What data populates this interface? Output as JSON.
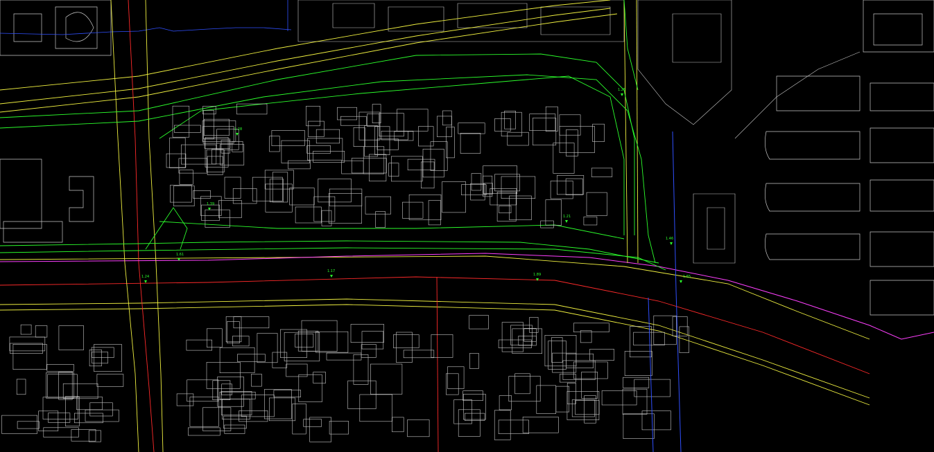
{
  "colors": {
    "background": "#000000",
    "building": "#c8c8c8",
    "road_edge": "#f0f040",
    "survey": "#2cff2c",
    "centerline": "#ff2a2a",
    "boundary": "#ff40ff",
    "pipe": "#3050ff",
    "text_white": "#d8d8d8",
    "text_green": "#2cff2c"
  },
  "labels": {
    "l1": "1.28",
    "l2": "1.39",
    "l3": "1.61",
    "l4": "1.24",
    "l5": "1.17",
    "l6": "1.89",
    "l7": "1.21",
    "l8": "1.65",
    "l9": "1.46",
    "l10": "1.25"
  }
}
